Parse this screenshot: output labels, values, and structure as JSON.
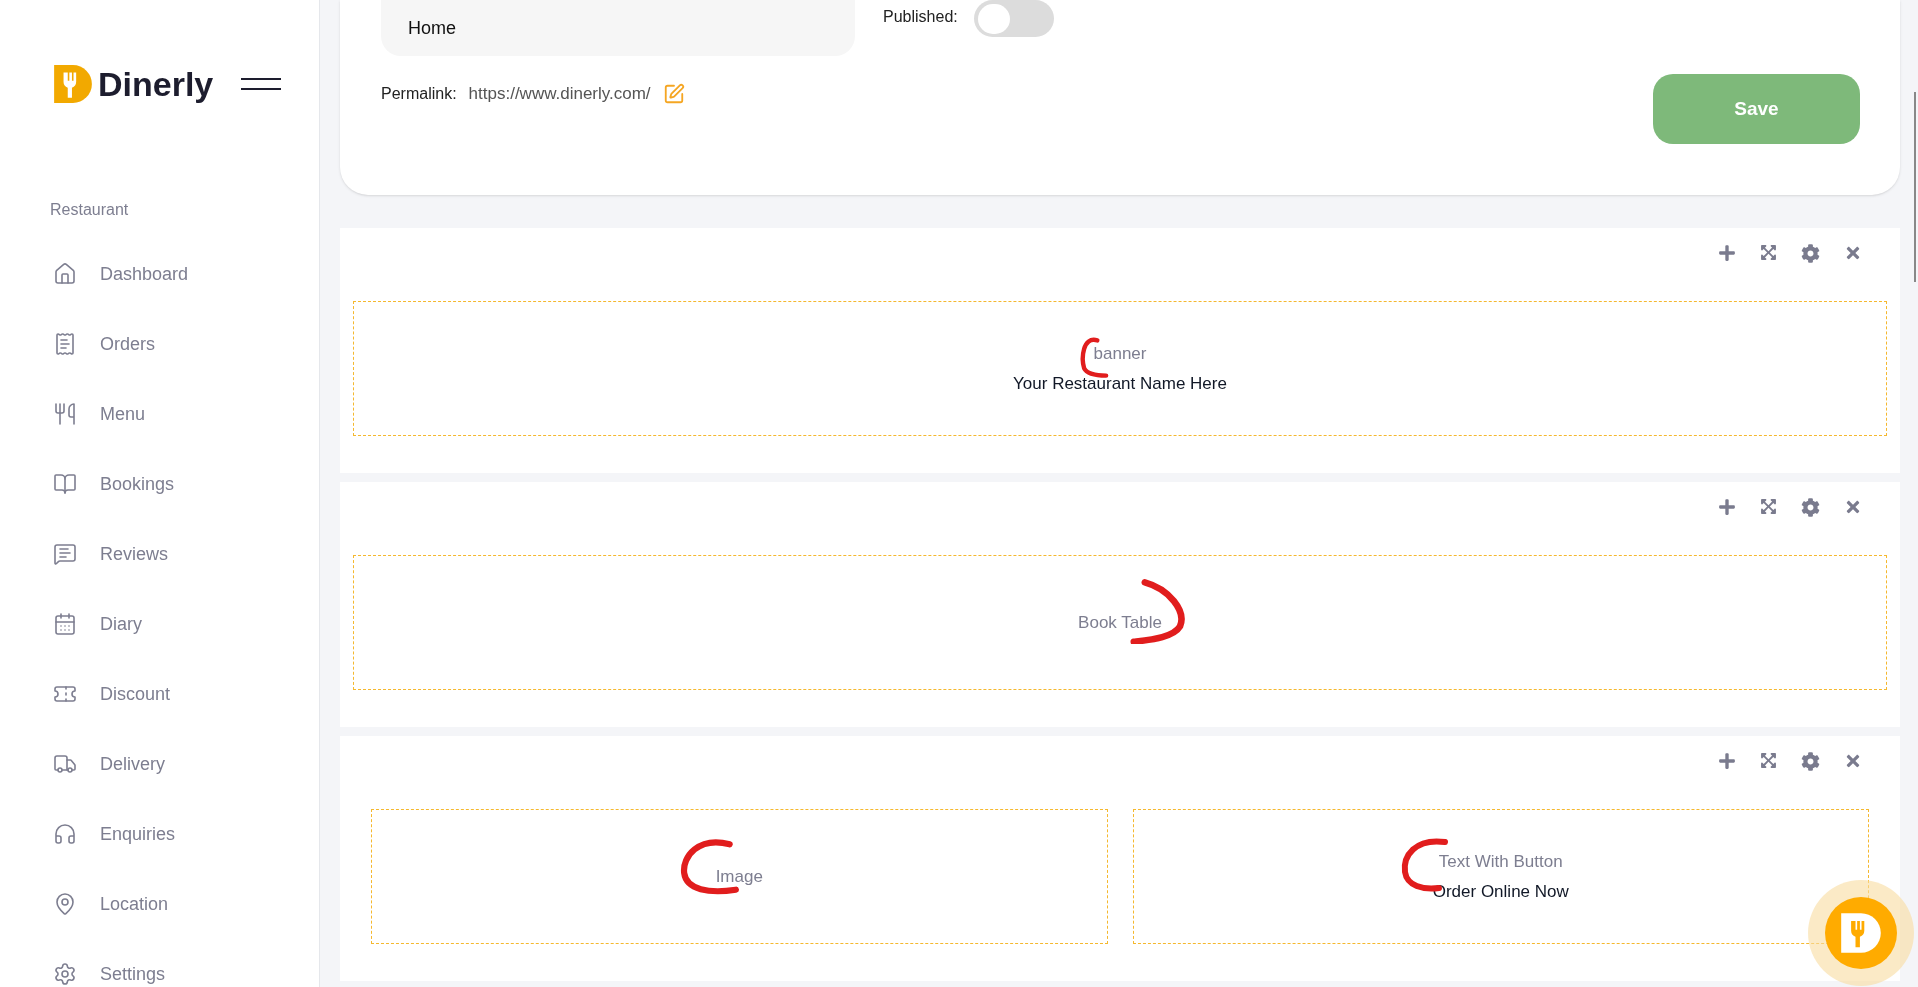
{
  "brand": {
    "name": "Dinerly"
  },
  "sidebar": {
    "section": "Restaurant",
    "items": [
      {
        "label": "Dashboard",
        "kind": "home",
        "selected": false
      },
      {
        "label": "Orders",
        "kind": "receipt",
        "selected": false
      },
      {
        "label": "Menu",
        "kind": "utensils",
        "selected": false
      },
      {
        "label": "Bookings",
        "kind": "book",
        "selected": false
      },
      {
        "label": "Reviews",
        "kind": "message",
        "selected": false
      },
      {
        "label": "Diary",
        "kind": "calendar",
        "selected": false
      },
      {
        "label": "Discount",
        "kind": "ticket",
        "selected": false
      },
      {
        "label": "Delivery",
        "kind": "truck",
        "selected": false
      },
      {
        "label": "Enquiries",
        "kind": "headphones",
        "selected": false
      },
      {
        "label": "Location",
        "kind": "pin",
        "selected": false
      },
      {
        "label": "Settings",
        "kind": "settings",
        "selected": false
      }
    ]
  },
  "page_form": {
    "title_field": {
      "value": "Home"
    },
    "published": {
      "label": "Published:",
      "on": false
    },
    "permalink": {
      "label": "Permalink:",
      "url": "https://www.dinerly.com/"
    },
    "save_button": "Save"
  },
  "sections": [
    {
      "blocks": [
        {
          "title": "banner",
          "subtitle": "Your Restaurant Name Here"
        }
      ]
    },
    {
      "blocks": [
        {
          "title": "Book Table"
        }
      ]
    },
    {
      "blocks": [
        {
          "title": "Image"
        },
        {
          "title": "Text With Button",
          "subtitle": "Order Online Now"
        }
      ]
    }
  ]
}
